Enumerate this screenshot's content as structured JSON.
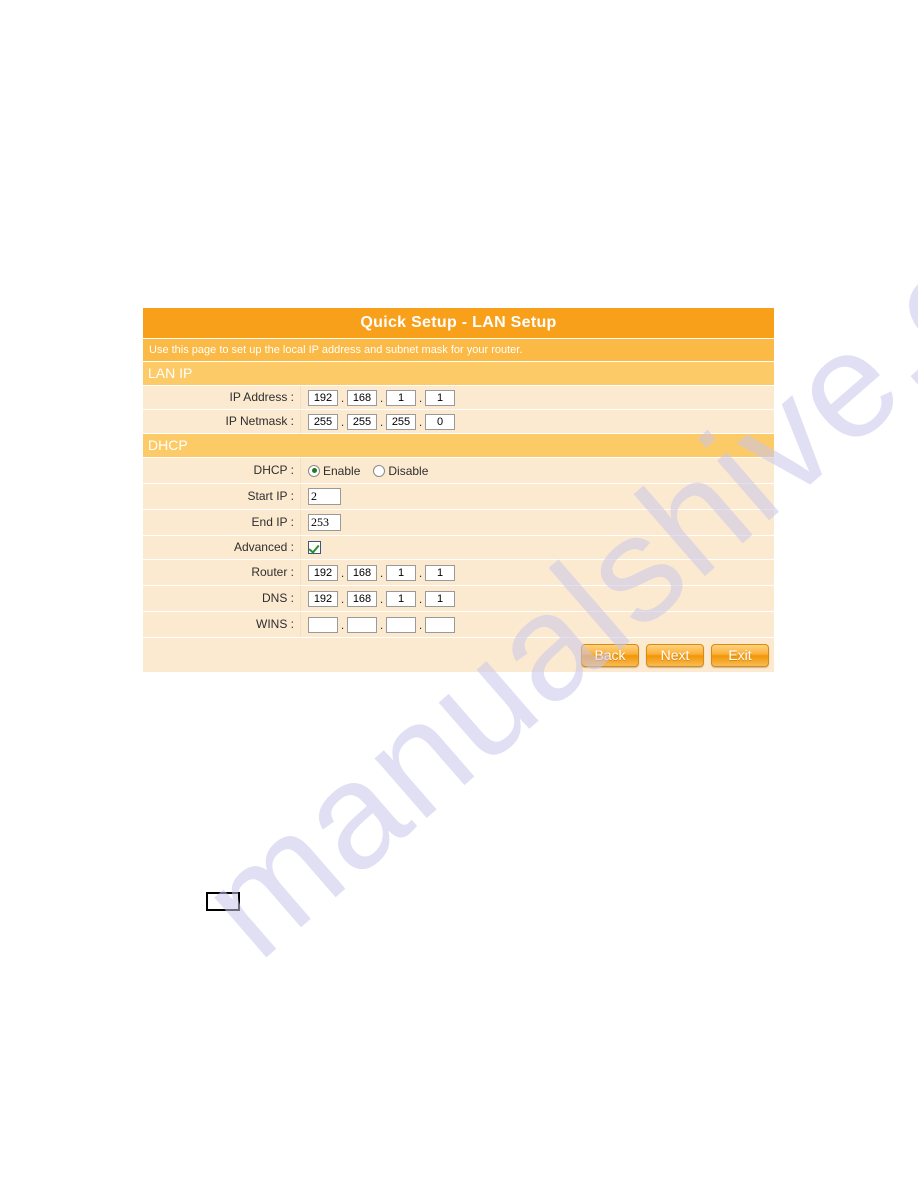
{
  "watermark": {
    "text": "manualshive.com"
  },
  "panel": {
    "title": "Quick Setup - LAN Setup",
    "description": "Use this page to set up the local IP address and subnet mask for your router.",
    "sections": {
      "lan_ip": {
        "heading": "LAN IP",
        "rows": [
          {
            "label": "IP Address :",
            "octets": [
              "192",
              "168",
              "1",
              "1"
            ],
            "separator": "."
          },
          {
            "label": "IP Netmask :",
            "octets": [
              "255",
              "255",
              "255",
              "0"
            ],
            "separator": "."
          }
        ]
      },
      "dhcp": {
        "heading": "DHCP",
        "dhcp_label": "DHCP :",
        "radio_options": [
          {
            "label": "Enable",
            "selected": true
          },
          {
            "label": "Disable",
            "selected": false
          }
        ],
        "start_ip_label": "Start IP :",
        "start_ip_value": "2",
        "end_ip_label": "End IP :",
        "end_ip_value": "253",
        "advanced_label": "Advanced :",
        "advanced_checked": true,
        "router_label": "Router :",
        "router_octets": [
          "192",
          "168",
          "1",
          "1"
        ],
        "dns_label": "DNS :",
        "dns_octets": [
          "192",
          "168",
          "1",
          "1"
        ],
        "wins_label": "WINS :",
        "wins_octets": [
          "",
          "",
          "",
          ""
        ],
        "separator": "."
      }
    },
    "buttons": [
      {
        "label": "Back",
        "name": "back-button"
      },
      {
        "label": "Next",
        "name": "next-button"
      },
      {
        "label": "Exit",
        "name": "exit-button"
      }
    ]
  },
  "page_box": {
    "value": ""
  },
  "colors": {
    "title_bar": "#f9a01b",
    "desc_bar": "#fbb945",
    "section_bar": "#fdca68",
    "row_bg": "#fcead0",
    "watermark": "#c9c6ea",
    "check_green": "#2a8f2a"
  }
}
